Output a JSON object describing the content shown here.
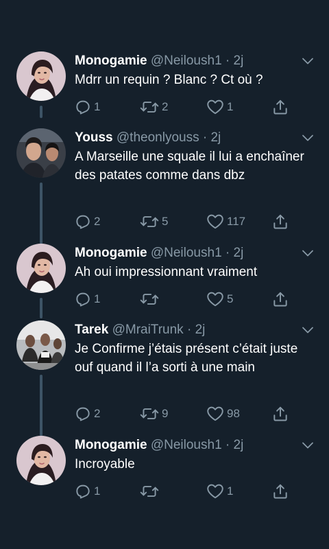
{
  "colors": {
    "background": "#15202b",
    "secondary_text": "#8899a6",
    "thread_line": "#3d5466"
  },
  "tweets": [
    {
      "name": "Monogamie",
      "handle": "@Neiloush1",
      "dot": "·",
      "time": "2j",
      "text": "Mdrr un requin ? Blanc ? Ct où ?",
      "replies": "1",
      "retweets": "2",
      "likes": "1",
      "avatar": "woman-portrait"
    },
    {
      "name": "Youss",
      "handle": "@theonlyouss",
      "dot": "·",
      "time": "2j",
      "text": "A Marseille une squale il lui a enchaîner des patates comme dans dbz",
      "replies": "2",
      "retweets": "5",
      "likes": "117",
      "avatar": "two-men-portrait"
    },
    {
      "name": "Monogamie",
      "handle": "@Neiloush1",
      "dot": "·",
      "time": "2j",
      "text": "Ah oui impressionnant vraiment",
      "replies": "1",
      "retweets": "",
      "likes": "5",
      "avatar": "woman-portrait"
    },
    {
      "name": "Tarek",
      "handle": "@MraiTrunk",
      "dot": "·",
      "time": "2j",
      "text": "Je Confirme j’étais présent c’était juste ouf quand il l’a sorti à une main",
      "replies": "2",
      "retweets": "9",
      "likes": "98",
      "avatar": "group-photo"
    },
    {
      "name": "Monogamie",
      "handle": "@Neiloush1",
      "dot": "·",
      "time": "2j",
      "text": "Incroyable",
      "replies": "1",
      "retweets": "",
      "likes": "1",
      "avatar": "woman-portrait"
    }
  ]
}
